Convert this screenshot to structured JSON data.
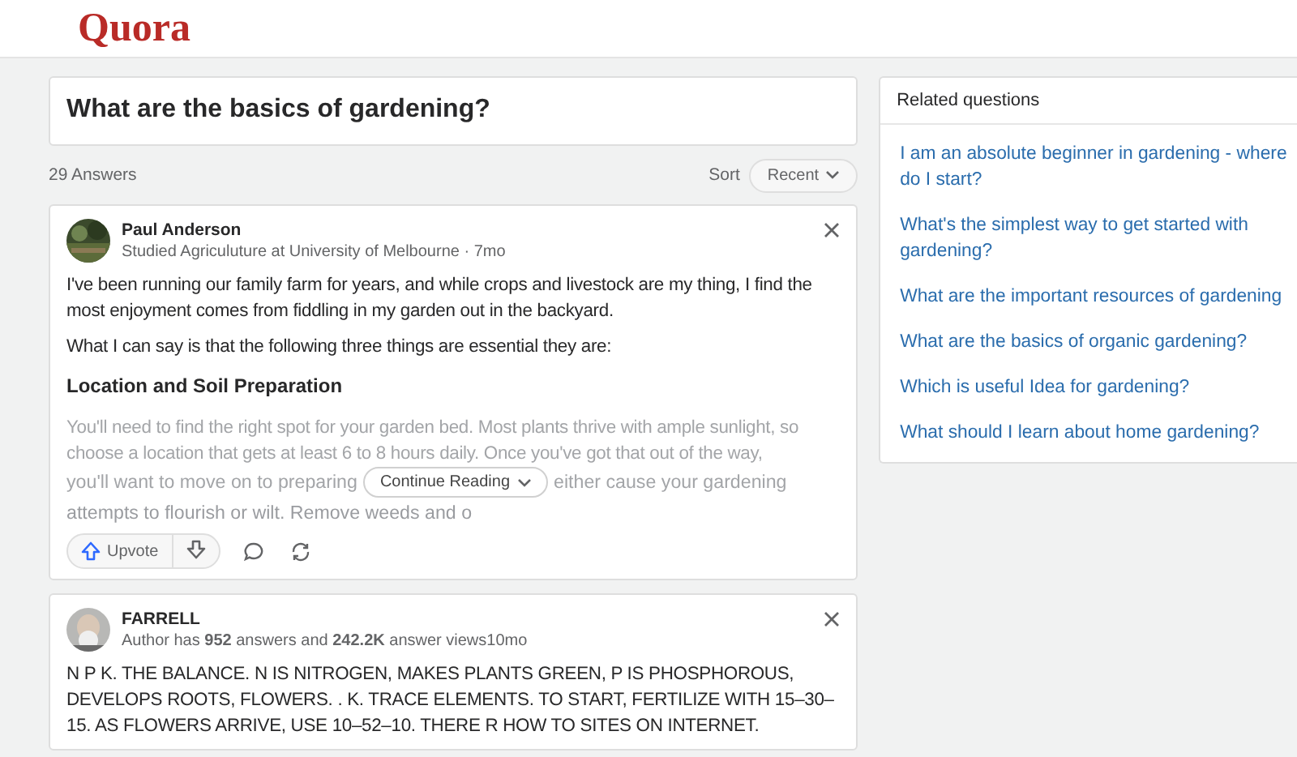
{
  "header": {
    "logo": "Quora"
  },
  "question": {
    "title": "What are the basics of gardening?"
  },
  "answers_bar": {
    "count": "29 Answers",
    "sort_label": "Sort",
    "sort_value": "Recent"
  },
  "answers": [
    {
      "author": "Paul Anderson",
      "credential": "Studied Agriculuture at University of Melbourne · 7mo",
      "paragraphs": [
        {
          "kind": "text",
          "text": "I've been running our family farm for years, and while crops and livestock are my thing, I find the most enjoyment comes from fiddling in my garden out in the backyard."
        },
        {
          "kind": "text",
          "text": "What I can say is that the following three things are essential they are:"
        },
        {
          "kind": "heading",
          "text": "Location and Soil Preparation"
        },
        {
          "kind": "faded",
          "text": "You'll need to find the right spot for your garden bed. Most plants thrive with ample sunlight, so choose a location that gets at least 6 to 8 hours daily. Once you've got that out of the way,"
        }
      ],
      "truncated": {
        "before": "you'll want to move on to preparing",
        "after": "either cause your gardening",
        "last": "attempts to flourish or wilt. Remove weeds and o",
        "button": "Continue Reading"
      },
      "actions": {
        "upvote": "Upvote"
      }
    },
    {
      "author": "FARRELL",
      "credential": "Author has **952** answers and **242.2K** answer views10mo",
      "paragraphs": [
        {
          "kind": "text",
          "text": "N P K. THE BALANCE. N IS NITROGEN, MAKES PLANTS GREEN, P IS PHOSPHOROUS, DEVELOPS ROOTS, FLOWERS. . K. TRACE ELEMENTS. TO START, FERTILIZE WITH 15–30–15. AS FLOWERS ARRIVE, USE 10–52–10. THERE R HOW TO SITES ON INTERNET."
        }
      ]
    }
  ],
  "related": {
    "title": "Related questions",
    "items": [
      {
        "lines": [
          "I am an absolute beginner in gardening - where",
          "do I start?"
        ]
      },
      {
        "lines": [
          "What's the simplest way to get started with",
          "gardening?"
        ]
      },
      {
        "lines": [
          "What are the important resources of gardening"
        ]
      },
      {
        "lines": [
          "What are the basics of organic gardening?"
        ]
      },
      {
        "lines": [
          "Which is useful Idea for gardening?"
        ]
      },
      {
        "lines": [
          "What should I learn about home gardening?"
        ]
      }
    ]
  }
}
